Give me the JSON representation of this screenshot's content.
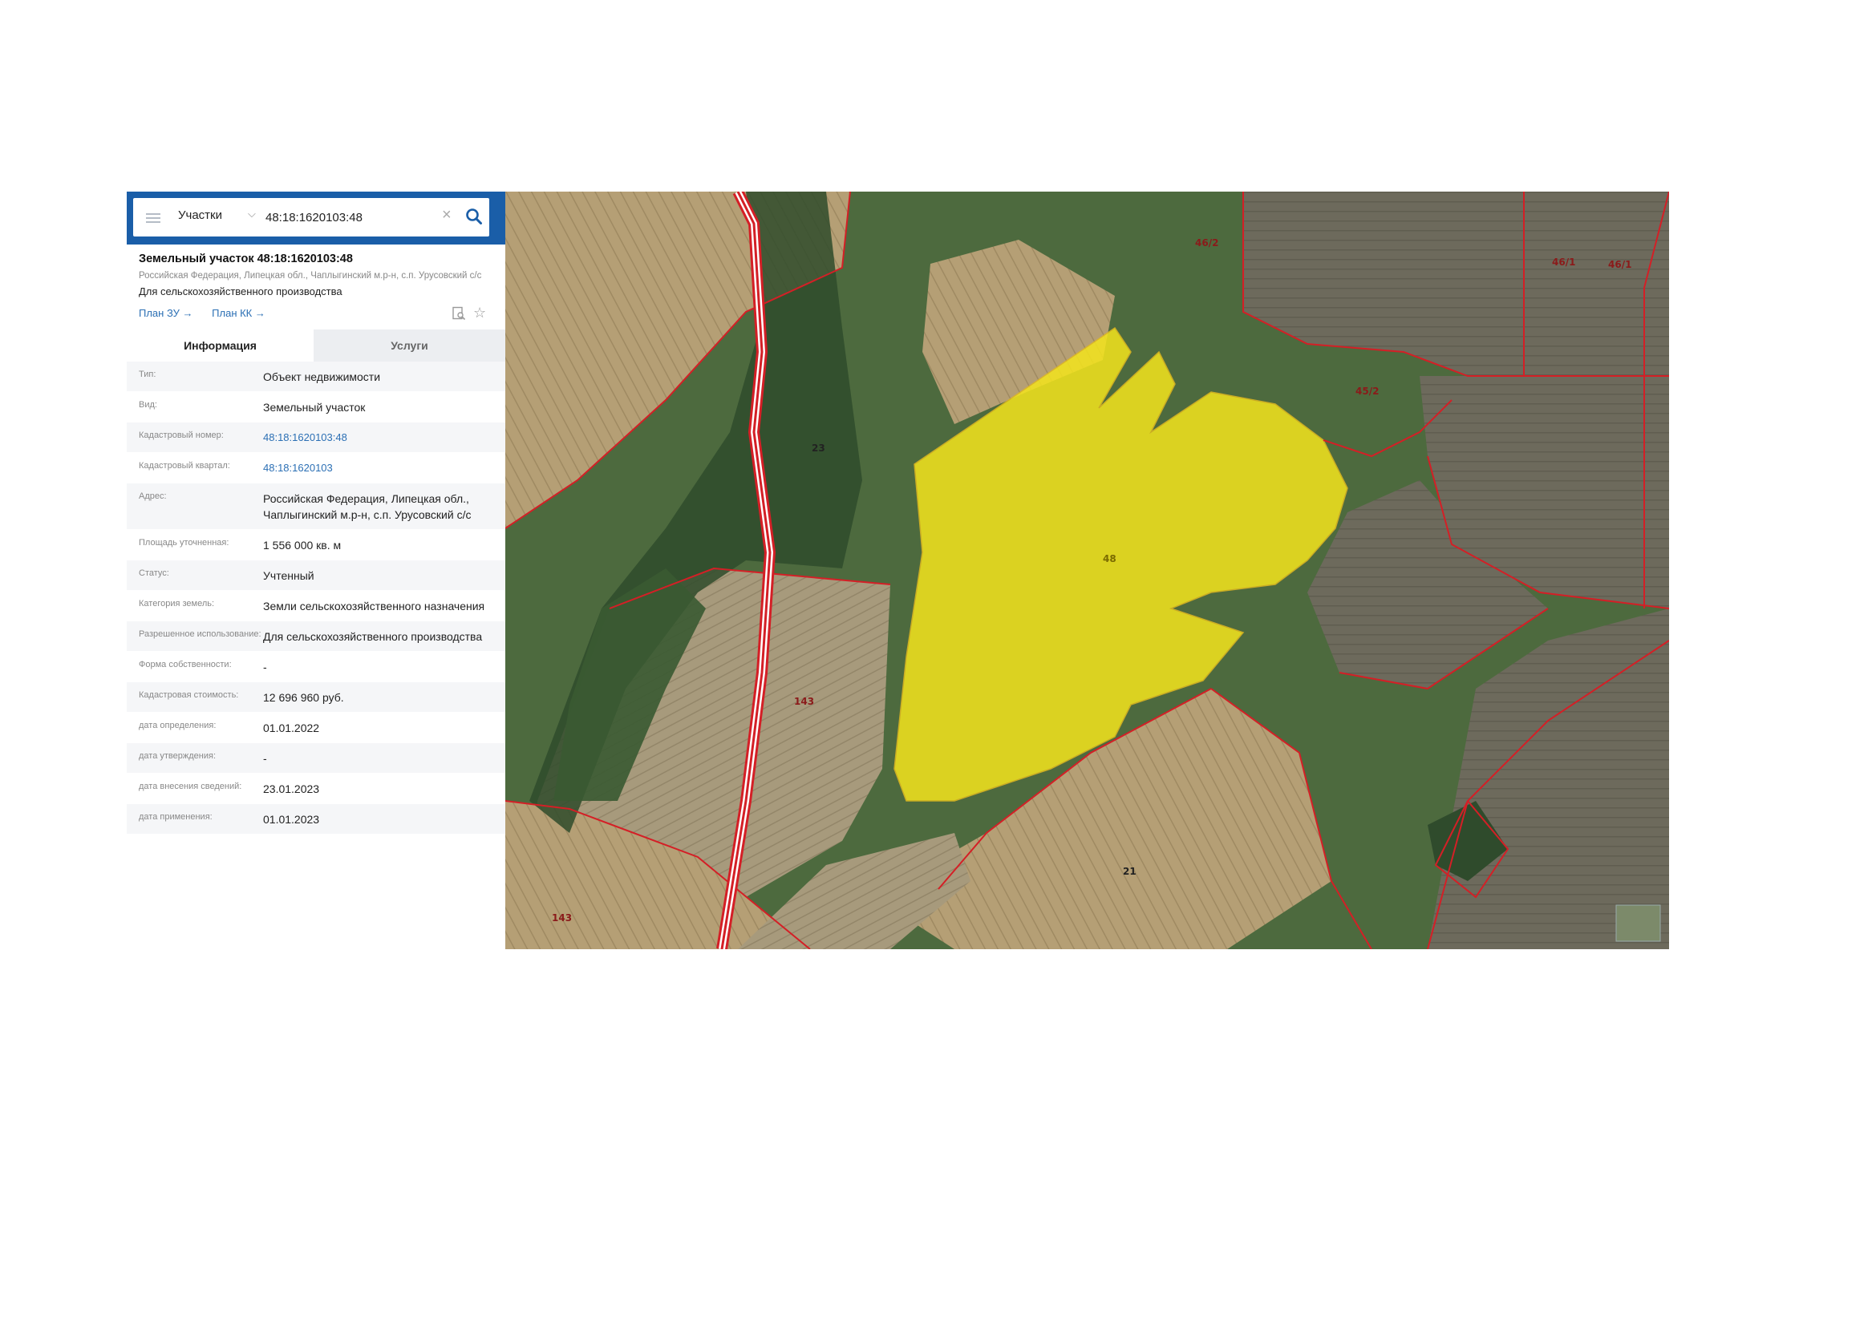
{
  "search": {
    "layer": "Участки",
    "value": "48:18:1620103:48"
  },
  "parcel": {
    "title": "Земельный участок 48:18:1620103:48",
    "address_line": "Российская Федерация, Липецкая обл., Чаплыгинский м.р-н, с.п. Урусовский с/с",
    "use": "Для сельскохозяйственного производства",
    "link_plan_zu": "План ЗУ →",
    "link_plan_kk": "План КК →"
  },
  "tabs": {
    "info": "Информация",
    "services": "Услуги"
  },
  "properties": [
    {
      "label": "Тип:",
      "value": "Объект недвижимости"
    },
    {
      "label": "Вид:",
      "value": "Земельный участок"
    },
    {
      "label": "Кадастровый номер:",
      "value": "48:18:1620103:48",
      "link": true
    },
    {
      "label": "Кадастровый квартал:",
      "value": "48:18:1620103",
      "link": true
    },
    {
      "label": "Адрес:",
      "value": "Российская Федерация, Липецкая обл., Чаплыгинский м.р-н, с.п. Урусовский с/с"
    },
    {
      "label": "Площадь уточненная:",
      "value": "1 556 000 кв. м"
    },
    {
      "label": "Статус:",
      "value": "Учтенный"
    },
    {
      "label": "Категория земель:",
      "value": "Земли сельскохозяйственного назначения"
    },
    {
      "label": "Разрешенное использование:",
      "value": "Для сельскохозяйственного производства"
    },
    {
      "label": "Форма собственности:",
      "value": "-"
    },
    {
      "label": "Кадастровая стоимость:",
      "value": "12 696 960 руб."
    },
    {
      "label": "дата определения:",
      "value": "01.01.2022"
    },
    {
      "label": "дата утверждения:",
      "value": "-"
    },
    {
      "label": "дата внесения сведений:",
      "value": "23.01.2023"
    },
    {
      "label": "дата применения:",
      "value": "01.01.2023"
    }
  ],
  "map_labels": [
    "46/2",
    "46/1",
    "46/1",
    "45/2",
    "23",
    "48",
    "143",
    "21",
    "143"
  ],
  "colors": {
    "header": "#1a5ea8",
    "link": "#2b6fb4",
    "parcel_fill": "#f4e51c",
    "boundary": "#d41f26"
  }
}
